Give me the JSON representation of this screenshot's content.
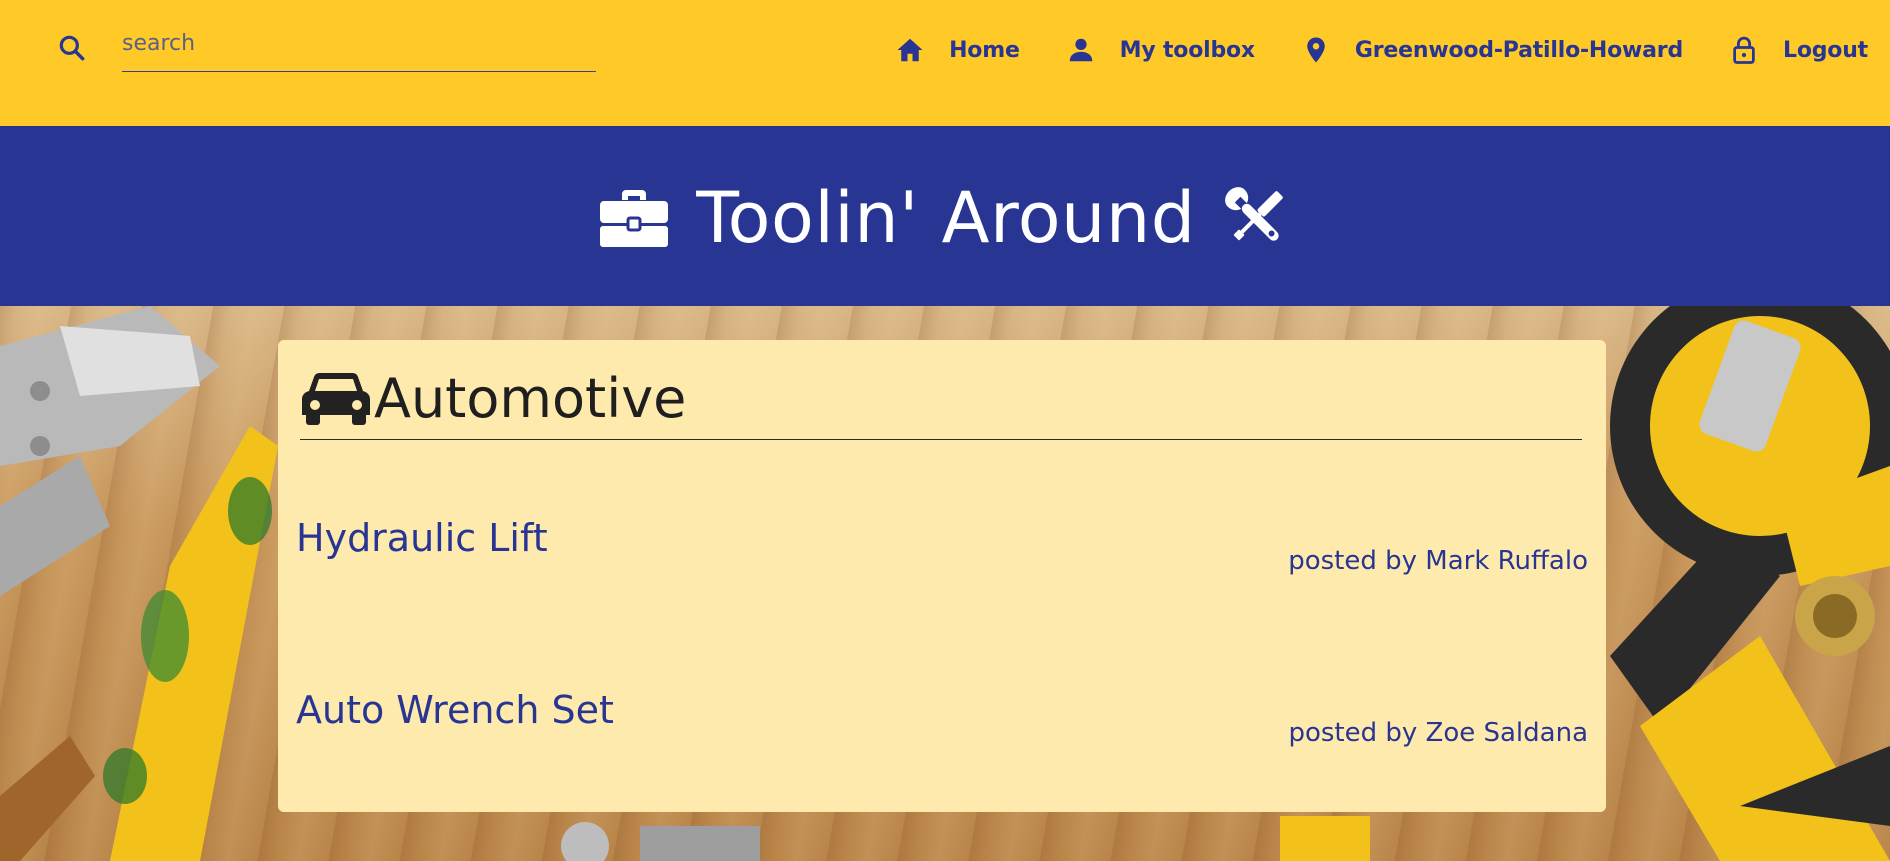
{
  "search": {
    "placeholder": "search",
    "value": ""
  },
  "nav": {
    "items": [
      {
        "label": "Home",
        "icon": "home-icon"
      },
      {
        "label": "My toolbox",
        "icon": "person-icon"
      },
      {
        "label": "Greenwood-Patillo-Howard",
        "icon": "location-pin-icon"
      },
      {
        "label": "Logout",
        "icon": "lock-icon"
      }
    ]
  },
  "banner": {
    "title": "Toolin' Around",
    "icons": [
      "toolbox-icon",
      "wrench-screwdriver-icon"
    ]
  },
  "category": {
    "title": "Automotive",
    "icon": "car-icon",
    "tools": [
      {
        "name": "Hydraulic Lift",
        "owner": "posted by Mark Ruffalo"
      },
      {
        "name": "Auto Wrench Set",
        "owner": "posted by Zoe Saldana"
      }
    ]
  },
  "colors": {
    "navbar": "#ffc928",
    "banner": "#283593",
    "card": "#ffeaad",
    "link": "#283593"
  }
}
